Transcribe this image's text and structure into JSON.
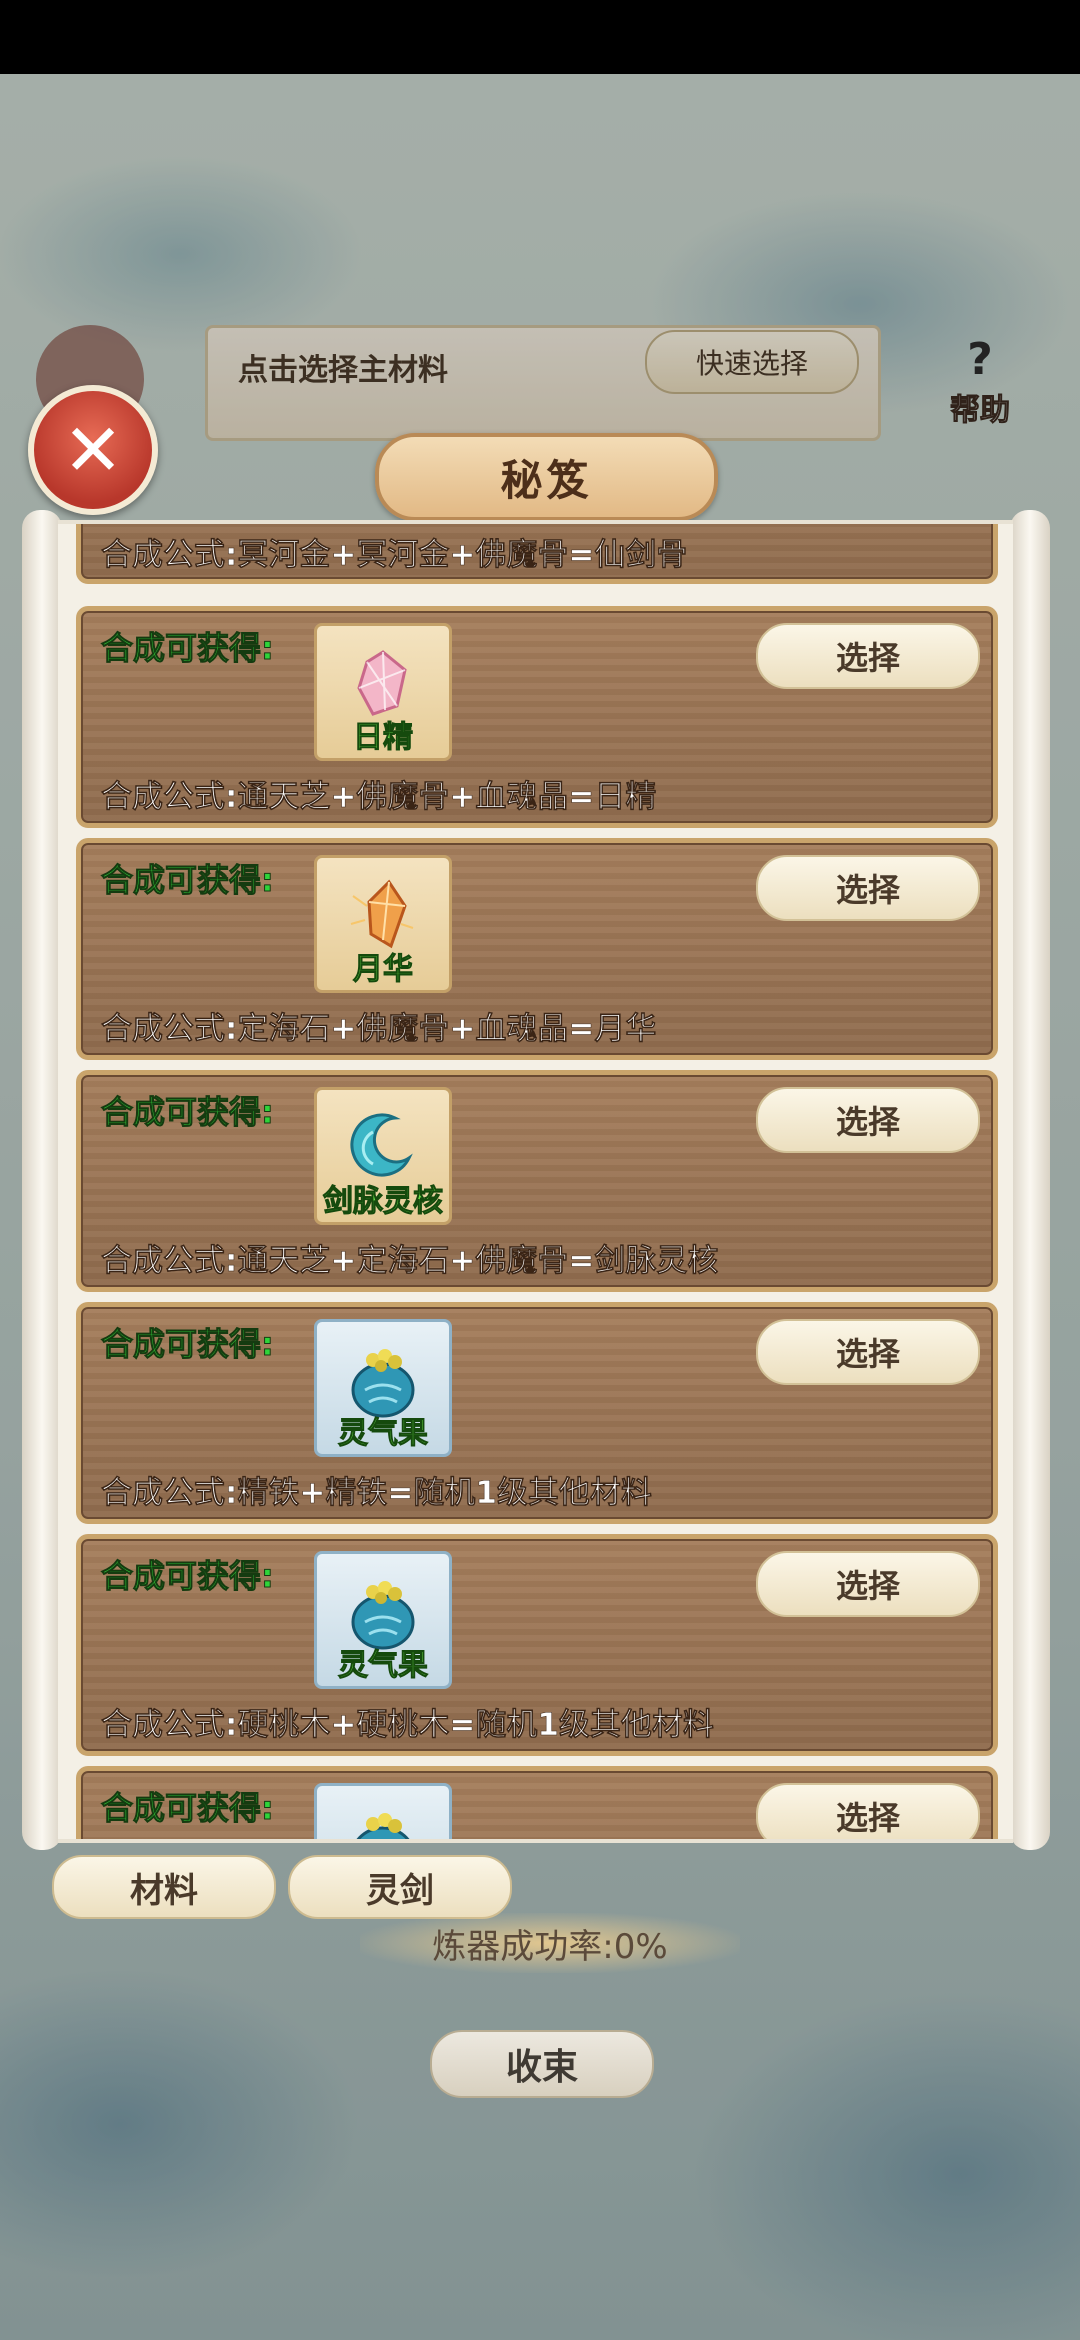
{
  "header": {
    "main_material_label": "点击选择主材料",
    "quick_select_label": "快速选择",
    "help_label": "帮助",
    "help_glyph": "?"
  },
  "dialog": {
    "title": "秘笈",
    "close_glyph": "✕"
  },
  "recipes": [
    {
      "formula": "合成公式:冥河金+冥河金+佛魔骨=仙剑骨"
    },
    {
      "get_label": "合成可获得:",
      "item_name": "日精",
      "icon": "pink-crystal-icon",
      "select_label": "选择",
      "formula": "合成公式:通天芝+佛魔骨+血魂晶=日精"
    },
    {
      "get_label": "合成可获得:",
      "item_name": "月华",
      "icon": "orange-crystal-icon",
      "select_label": "选择",
      "formula": "合成公式:定海石+佛魔骨+血魂晶=月华"
    },
    {
      "get_label": "合成可获得:",
      "item_name": "剑脉灵核",
      "icon": "blue-ring-icon",
      "select_label": "选择",
      "formula": "合成公式:通天芝+定海石+佛魔骨=剑脉灵核"
    },
    {
      "get_label": "合成可获得:",
      "item_name": "灵气果",
      "icon": "fruit-bag-icon",
      "select_label": "选择",
      "formula": "合成公式:精铁+精铁=随机1级其他材料"
    },
    {
      "get_label": "合成可获得:",
      "item_name": "灵气果",
      "icon": "fruit-bag-icon",
      "select_label": "选择",
      "formula": "合成公式:硬桃木+硬桃木=随机1级其他材料"
    },
    {
      "get_label": "合成可获得:",
      "icon": "fruit-bag-icon",
      "select_label": "选择"
    }
  ],
  "tabs": {
    "materials": "材料",
    "sword": "灵剑"
  },
  "success_rate": "炼器成功率:0%",
  "end_button": "收束"
}
